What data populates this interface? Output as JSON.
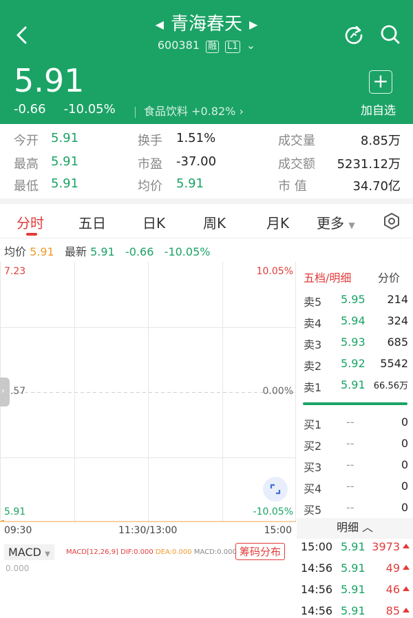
{
  "header": {
    "stock_name": "青海春天",
    "stock_code": "600381",
    "tag_margin": "融",
    "tag_level": "L1",
    "price": "5.91",
    "change": "-0.66",
    "change_pct": "-10.05%",
    "sector_name": "食品饮料",
    "sector_change": "+0.82%",
    "add_watch_label": "加自选",
    "icons": [
      "back-icon",
      "refresh-icon",
      "search-icon",
      "plus-icon"
    ]
  },
  "stats": {
    "open_label": "今开",
    "open": "5.91",
    "high_label": "最高",
    "high": "5.91",
    "low_label": "最低",
    "low": "5.91",
    "turnover_label": "换手",
    "turnover": "1.51%",
    "pe_label": "市盈",
    "pe": "-37.00",
    "avg_label": "均价",
    "avg": "5.91",
    "volume_label": "成交量",
    "volume": "8.85万",
    "amount_label": "成交额",
    "amount": "5231.12万",
    "mktcap_label": "市 值",
    "mktcap": "34.70亿"
  },
  "tabs": [
    "分时",
    "五日",
    "日K",
    "周K",
    "月K",
    "更多"
  ],
  "avg_row": {
    "avg_label": "均价",
    "avg": "5.91",
    "latest_label": "最新",
    "latest": "5.91",
    "change": "-0.66",
    "change_pct": "-10.05%"
  },
  "chart_data": {
    "type": "line",
    "y_top_label": "7.23",
    "y_mid_label": "6.57",
    "y_bottom_label": "5.91",
    "pct_top_label": "10.05%",
    "pct_mid_label": "0.00%",
    "pct_bottom_label": "-10.05%",
    "x_labels": [
      "09:30",
      "11:30/13:00",
      "15:00"
    ],
    "ylim": [
      5.91,
      7.23
    ],
    "series": [
      {
        "values": [
          5.91,
          5.91
        ]
      }
    ]
  },
  "macd": {
    "button": "MACD",
    "params": "MACD[12,26,9]",
    "dif": "DIF:0.000",
    "dea": "DEA:0.000",
    "macd": "MACD:0.000",
    "chip_button": "筹码分布",
    "zero": "0.000"
  },
  "book": {
    "title": "五档/明细",
    "tab2": "分价",
    "asks": [
      {
        "label": "卖5",
        "price": "5.95",
        "vol": "214"
      },
      {
        "label": "卖4",
        "price": "5.94",
        "vol": "324"
      },
      {
        "label": "卖3",
        "price": "5.93",
        "vol": "685"
      },
      {
        "label": "卖2",
        "price": "5.92",
        "vol": "5542"
      },
      {
        "label": "卖1",
        "price": "5.91",
        "vol": "66.56万"
      }
    ],
    "bids": [
      {
        "label": "买1",
        "price": "--",
        "vol": "0"
      },
      {
        "label": "买2",
        "price": "--",
        "vol": "0"
      },
      {
        "label": "买3",
        "price": "--",
        "vol": "0"
      },
      {
        "label": "买4",
        "price": "--",
        "vol": "0"
      },
      {
        "label": "买5",
        "price": "--",
        "vol": "0"
      }
    ],
    "detail_label": "明细",
    "ticks": [
      {
        "time": "15:00",
        "price": "5.91",
        "vol": "3973"
      },
      {
        "time": "14:56",
        "price": "5.91",
        "vol": "49"
      },
      {
        "time": "14:56",
        "price": "5.91",
        "vol": "46"
      },
      {
        "time": "14:56",
        "price": "5.91",
        "vol": "85"
      }
    ]
  },
  "colors": {
    "brand_green": "#1ba366",
    "down_green": "#1aa365",
    "up_red": "#e23b3b",
    "avg_orange": "#f09a2b"
  }
}
